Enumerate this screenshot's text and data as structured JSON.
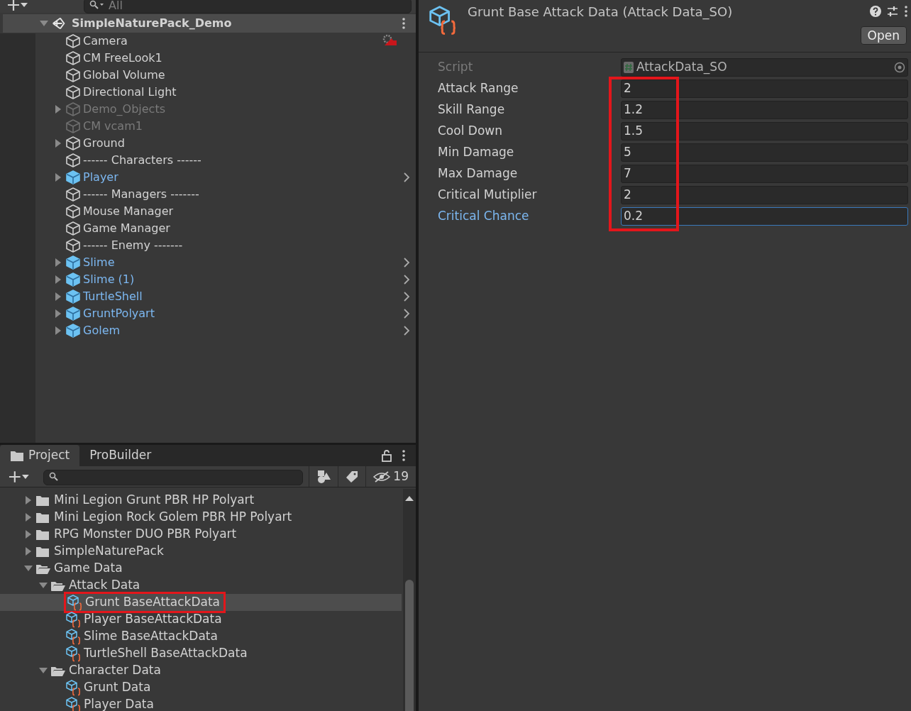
{
  "hierarchy": {
    "search": {
      "placeholder": "All"
    },
    "scene": {
      "name": "SimpleNaturePack_Demo",
      "expanded": true,
      "children": [
        {
          "name": "Camera",
          "kind": "object",
          "active": true,
          "gizmo": true
        },
        {
          "name": "CM FreeLook1",
          "kind": "object",
          "active": true,
          "gizmo": false
        },
        {
          "name": "Global Volume",
          "kind": "object",
          "active": true,
          "gizmo": false
        },
        {
          "name": "Directional Light",
          "kind": "object",
          "active": true,
          "gizmo": false
        },
        {
          "name": "Demo_Objects",
          "kind": "object",
          "active": false,
          "expanded": false,
          "gizmo": false
        },
        {
          "name": "CM vcam1",
          "kind": "object",
          "active": false,
          "gizmo": false
        },
        {
          "name": "Ground",
          "kind": "object",
          "active": true,
          "expanded": false,
          "gizmo": false
        },
        {
          "name": "------ Characters ------",
          "kind": "object",
          "active": true,
          "gizmo": false
        },
        {
          "name": "Player",
          "kind": "prefab",
          "active": true,
          "expanded": false,
          "gizmo": false
        },
        {
          "name": "------ Managers -------",
          "kind": "object",
          "active": true,
          "gizmo": false
        },
        {
          "name": "Mouse Manager",
          "kind": "object",
          "active": true,
          "gizmo": false
        },
        {
          "name": "Game Manager",
          "kind": "object",
          "active": true,
          "gizmo": false
        },
        {
          "name": "------ Enemy -------",
          "kind": "object",
          "active": true,
          "gizmo": false
        },
        {
          "name": "Slime",
          "kind": "prefab",
          "active": true,
          "expanded": false,
          "gizmo": false
        },
        {
          "name": "Slime (1)",
          "kind": "prefab",
          "active": true,
          "expanded": false,
          "gizmo": false
        },
        {
          "name": "TurtleShell",
          "kind": "prefab",
          "active": true,
          "expanded": false,
          "gizmo": false
        },
        {
          "name": "GruntPolyart",
          "kind": "prefab",
          "active": true,
          "expanded": false,
          "gizmo": false
        },
        {
          "name": "Golem",
          "kind": "prefab",
          "active": true,
          "expanded": false,
          "gizmo": false
        }
      ]
    }
  },
  "project": {
    "tabs": [
      {
        "label": "Project",
        "selected": true
      },
      {
        "label": "ProBuilder",
        "selected": false
      }
    ],
    "hidden_count": "19",
    "tree": [
      {
        "children": [
          {
            "name": "Mini Legion Grunt PBR HP Polyart",
            "kind": "folder",
            "expanded": false,
            "selected": false
          },
          {
            "name": "Mini Legion Rock Golem PBR HP Polyart",
            "kind": "folder",
            "expanded": false,
            "selected": false
          },
          {
            "name": "RPG Monster DUO PBR Polyart",
            "kind": "folder",
            "expanded": false,
            "selected": false
          },
          {
            "name": "SimpleNaturePack",
            "kind": "folder",
            "expanded": false,
            "selected": false
          }
        ]
      },
      {
        "name": "Game Data",
        "kind": "folder",
        "expanded": true,
        "selected": false,
        "children": [
          {
            "name": "Attack Data",
            "kind": "folder",
            "expanded": true,
            "selected": false,
            "children": [
              {
                "name": "Grunt BaseAttackData",
                "kind": "asset",
                "selected": true,
                "annotated": true
              },
              {
                "name": "Player BaseAttackData",
                "kind": "asset",
                "selected": false
              },
              {
                "name": "Slime BaseAttackData",
                "kind": "asset",
                "selected": false
              },
              {
                "name": "TurtleShell BaseAttackData",
                "kind": "asset",
                "selected": false
              }
            ]
          },
          {
            "name": "Character Data",
            "kind": "folder",
            "expanded": true,
            "selected": false,
            "children": [
              {
                "name": "Grunt Data",
                "kind": "asset",
                "selected": false
              },
              {
                "name": "Player Data",
                "kind": "asset",
                "selected": false
              }
            ]
          }
        ]
      }
    ]
  },
  "inspector": {
    "title": "Grunt Base Attack Data (Attack Data_SO)",
    "open_button": "Open",
    "script": {
      "label": "Script",
      "value": "AttackData_SO"
    },
    "values_annotated": true,
    "fields": [
      {
        "label": "Attack Range",
        "value": "2",
        "focused": false
      },
      {
        "label": "Skill Range",
        "value": "1.2",
        "focused": false
      },
      {
        "label": "Cool Down",
        "value": "1.5",
        "focused": false
      },
      {
        "label": "Min Damage",
        "value": "5",
        "focused": false
      },
      {
        "label": "Max Damage",
        "value": "7",
        "focused": false
      },
      {
        "label": "Critical Mutiplier",
        "value": "2",
        "focused": false
      },
      {
        "label": "Critical Chance",
        "value": "0.2",
        "focused": true
      }
    ]
  }
}
